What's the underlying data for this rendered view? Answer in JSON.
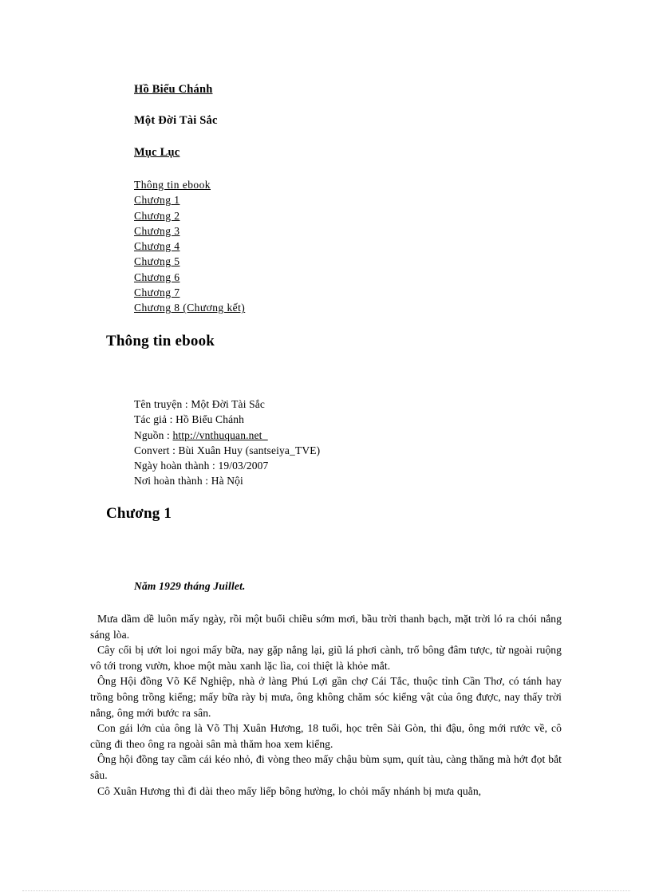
{
  "document": {
    "author": "Hồ Biểu Chánh",
    "book_title": "Một Đời Tài Sắc",
    "toc_title": "Mục Lục"
  },
  "toc": {
    "items": [
      {
        "label": "Thông tin ebook"
      },
      {
        "label": "Chương 1"
      },
      {
        "label": "Chương 2"
      },
      {
        "label": "Chương 3"
      },
      {
        "label": "Chương 4"
      },
      {
        "label": "Chương 5"
      },
      {
        "label": "Chương 6"
      },
      {
        "label": "Chương 7"
      },
      {
        "label": "Chương 8 (Chương kết)"
      }
    ]
  },
  "ebook_info": {
    "heading": "Thông tin ebook",
    "fields": [
      {
        "label": "Tên truyện : ",
        "value": "Một Đời Tài Sắc"
      },
      {
        "label": "Tác giả : ",
        "value": "Hồ Biểu Chánh"
      },
      {
        "label": "Nguồn : ",
        "value": "http://vnthuquan.net"
      },
      {
        "label": "Convert : ",
        "value": "Bùi Xuân Huy (santseiya_TVE)"
      },
      {
        "label": "Ngày hoàn thành : ",
        "value": "19/03/2007"
      },
      {
        "label": "Nơi hoàn thành : ",
        "value": "Hà Nội"
      }
    ]
  },
  "chapter": {
    "heading": "Chương 1",
    "date_line": "Năm 1929 tháng Juillet.",
    "paragraphs": [
      "Mưa dầm dề luôn mấy ngày, rồi một buổi chiều sớm mơi, bầu trời thanh bạch, mặt trời ló ra chói nắng sáng lòa.",
      "Cây cối bị ướt loi ngoi mấy bữa, nay gặp nắng lại, giũ lá phơi cành, trổ bông đâm tược, từ ngoài ruộng vô tới trong vườn, khoe một màu xanh lặc lìa, coi thiệt là khỏe mắt.",
      "Ông Hội đồng Võ Kế Nghiệp, nhà ở làng Phú Lợi gần chợ Cái Tắc, thuộc tỉnh Cần Thơ, có tánh hay trồng bông trồng kiểng; mấy bữa rày bị mưa, ông không chăm sóc kiểng vật của ông được, nay thấy trời nắng, ông mới bước ra sân.",
      "Con gái lớn của ông là Võ Thị Xuân Hương, 18 tuổi, học trên Sài Gòn, thi đậu, ông mới rước về, cô cũng đi theo ông ra ngoài sân mà thăm hoa xem kiểng.",
      "Ông hội đồng tay cầm cái kéo nhỏ, đi vòng theo mấy chậu bùm sụm, quít tàu, càng thăng mà hớt đọt bắt sâu.",
      "Cô Xuân Hương thì đi dài theo mấy liếp bông hường, lo chỏi mấy nhánh bị mưa quằn,"
    ]
  }
}
